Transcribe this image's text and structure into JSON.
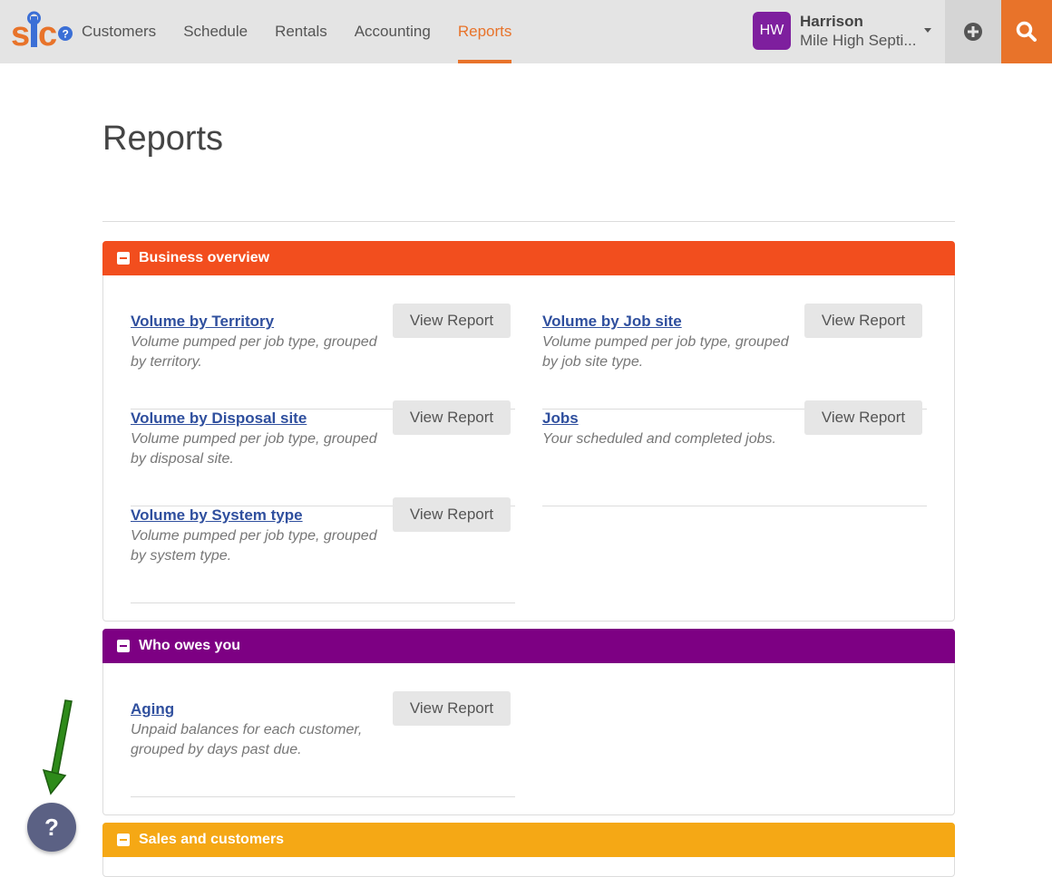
{
  "header": {
    "logo_text": "SIC",
    "nav": [
      {
        "label": "Customers"
      },
      {
        "label": "Schedule"
      },
      {
        "label": "Rentals"
      },
      {
        "label": "Accounting"
      },
      {
        "label": "Reports",
        "active": true
      }
    ],
    "user": {
      "initials": "HW",
      "name": "Harrison",
      "company": "Mile High Septi..."
    },
    "add_icon": "plus-circle-icon",
    "search_icon": "search-icon"
  },
  "page": {
    "title": "Reports",
    "view_button_label": "View Report"
  },
  "sections": [
    {
      "title": "Business overview",
      "color": "#f24e1e",
      "reports": [
        {
          "name": "Volume by Territory",
          "desc": "Volume pumped per job type, grouped by territory."
        },
        {
          "name": "Volume by Job site",
          "desc": "Volume pumped per job type, grouped by job site type."
        },
        {
          "name": "Volume by Disposal site",
          "desc": "Volume pumped per job type, grouped by disposal site."
        },
        {
          "name": "Jobs",
          "desc": "Your scheduled and completed jobs."
        },
        {
          "name": "Volume by System type",
          "desc": "Volume pumped per job type, grouped by system type."
        }
      ]
    },
    {
      "title": "Who owes you",
      "color": "#7d0083",
      "reports": [
        {
          "name": "Aging",
          "desc": "Unpaid balances for each customer, grouped by days past due."
        }
      ]
    },
    {
      "title": "Sales and customers",
      "color": "#f5a815",
      "reports": []
    }
  ],
  "help": {
    "label": "?"
  },
  "colors": {
    "accent": "#e8732a",
    "link": "#2f4f9e",
    "avatar": "#7e1f9e",
    "annotation_arrow": "#2e8b1a"
  }
}
